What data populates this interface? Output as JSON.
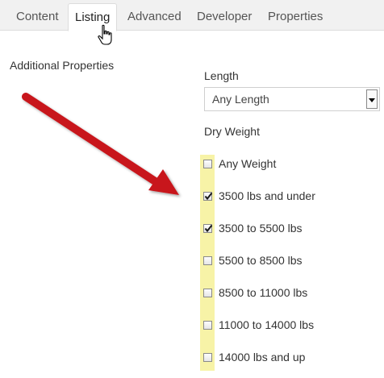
{
  "tabs": [
    {
      "label": "Content",
      "active": false
    },
    {
      "label": "Listing",
      "active": true
    },
    {
      "label": "Advanced",
      "active": false
    },
    {
      "label": "Developer",
      "active": false
    },
    {
      "label": "Properties",
      "active": false
    }
  ],
  "section_title": "Additional Properties",
  "length": {
    "label": "Length",
    "selected": "Any Length"
  },
  "dry_weight": {
    "label": "Dry Weight",
    "options": [
      {
        "label": "Any Weight",
        "checked": false
      },
      {
        "label": "3500 lbs and under",
        "checked": true
      },
      {
        "label": "3500 to 5500 lbs",
        "checked": true
      },
      {
        "label": "5500 to 8500 lbs",
        "checked": false
      },
      {
        "label": "8500 to 11000 lbs",
        "checked": false
      },
      {
        "label": "11000 to 14000 lbs",
        "checked": false
      },
      {
        "label": "14000 lbs and up",
        "checked": false
      }
    ]
  },
  "colors": {
    "highlight": "#f7f3a7",
    "arrow": "#c8151b",
    "tab_bar": "#f1f1f1"
  },
  "icons": {
    "cursor": "hand-pointer-icon",
    "annotation": "red-arrow-icon",
    "dropdown": "triangle-down-icon"
  }
}
